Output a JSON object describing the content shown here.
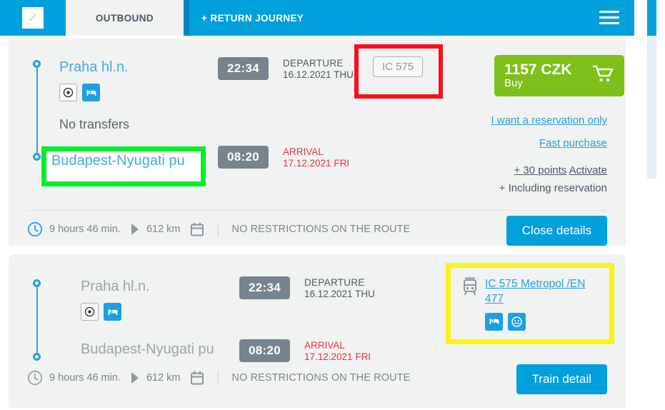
{
  "header": {
    "checkbox_icon": "check-icon",
    "checkbox_checked": true,
    "tab_outbound": "OUTBOUND",
    "tab_return": "+ RETURN JOURNEY",
    "menu_icon": "hamburger-icon"
  },
  "journeys": [
    {
      "id": "journey-expanded",
      "origin": "Praha hl.n.",
      "destination": "Budapest-Nyugati pu",
      "transfers_text": "No transfers",
      "departure_time": "22:34",
      "departure_label": "DEPARTURE",
      "departure_date": "16.12.2021 THU",
      "arrival_time": "08:20",
      "arrival_label": "ARRIVAL",
      "arrival_date": "17.12.2021 FRI",
      "train_badge": "IC 575",
      "amenities": [
        "target-icon",
        "bed-icon"
      ],
      "price": "1157 CZK",
      "buy_label": "Buy",
      "cart_icon": "shopping-cart-icon",
      "link_reservation": "I want a reservation only",
      "link_fast_purchase": "Fast purchase",
      "points_text": "+ 30 points",
      "points_activate": "Activate",
      "including_reservation": "+ Including reservation",
      "duration": "9 hours 46 min.",
      "distance": "612 km",
      "restrictions": "NO RESTRICTIONS ON THE ROUTE",
      "action_button": "Close details",
      "clock_icon": "clock-icon",
      "arrow_icon": "play-arrow-icon",
      "calendar_icon": "calendar-icon"
    },
    {
      "id": "journey-collapsed",
      "origin": "Praha hl.n.",
      "destination": "Budapest-Nyugati pu",
      "departure_time": "22:34",
      "departure_label": "DEPARTURE",
      "departure_date": "16.12.2021 THU",
      "arrival_time": "08:20",
      "arrival_label": "ARRIVAL",
      "arrival_date": "17.12.2021 FRI",
      "amenities": [
        "target-icon",
        "bed-icon"
      ],
      "train_icon": "tram-icon",
      "train_link": "IC 575 Metropol /EN 477",
      "train_amenities": [
        "bed-icon",
        "socket-icon"
      ],
      "duration": "9 hours 46 min.",
      "distance": "612 km",
      "restrictions": "NO RESTRICTIONS ON THE ROUTE",
      "action_button": "Train detail",
      "clock_icon": "clock-icon",
      "arrow_icon": "play-arrow-icon",
      "calendar_icon": "calendar-icon"
    }
  ],
  "annotations": [
    {
      "name": "red-highlight-train-badge",
      "color": "#fc0d1c"
    },
    {
      "name": "green-highlight-destination",
      "color": "#00f028"
    },
    {
      "name": "yellow-highlight-train-link",
      "color": "#fbf315"
    }
  ],
  "colors": {
    "brand_blue": "#00a0dd",
    "link_blue": "#2b9fd9",
    "buy_green": "#7dc01a",
    "arrival_red": "#e2343f",
    "chip_gray": "#77838d",
    "card_bg": "#f1f2f2"
  },
  "scrollbar": {
    "name": "vertical-scrollbar",
    "thumb_position": "top"
  }
}
